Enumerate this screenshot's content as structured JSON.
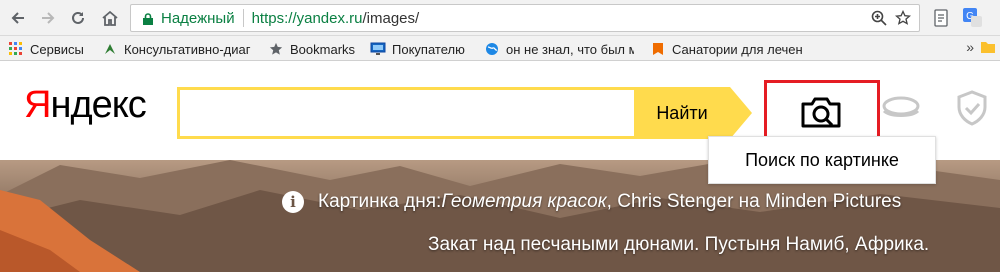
{
  "browser": {
    "security_label": "Надежный",
    "url_base": "https://yandex.ru",
    "url_rest": "/images/",
    "bookmarks": [
      {
        "label": "Сервисы",
        "icon": "apps-grid-icon"
      },
      {
        "label": "Консультативно-диаг",
        "icon": "green-leaf-icon"
      },
      {
        "label": "Bookmarks",
        "icon": "star-icon"
      },
      {
        "label": "Покупателю",
        "icon": "monitor-icon"
      },
      {
        "label": "он не знал, что был м",
        "icon": "globe-icon"
      },
      {
        "label": "Санатории для лечен",
        "icon": "orange-bookmark-icon"
      }
    ],
    "bookmarks_more": "»"
  },
  "page": {
    "logo": "Яндекс",
    "logo_first": "Я",
    "logo_rest": "ндекс",
    "search_value": "",
    "search_button": "Найти",
    "tooltip": "Поиск по картинке",
    "caption": {
      "prefix": "Картинка дня: ",
      "title": "Геометрия красок",
      "suffix": ", Chris Stenger на Minden Pictures",
      "description": "Закат над песчаными дюнами. Пустыня Намиб, Африка."
    }
  },
  "colors": {
    "accent_yellow": "#ffdb4d",
    "logo_red": "#ff0000",
    "highlight_red": "#e51c23",
    "secure_green": "#0b8043"
  }
}
